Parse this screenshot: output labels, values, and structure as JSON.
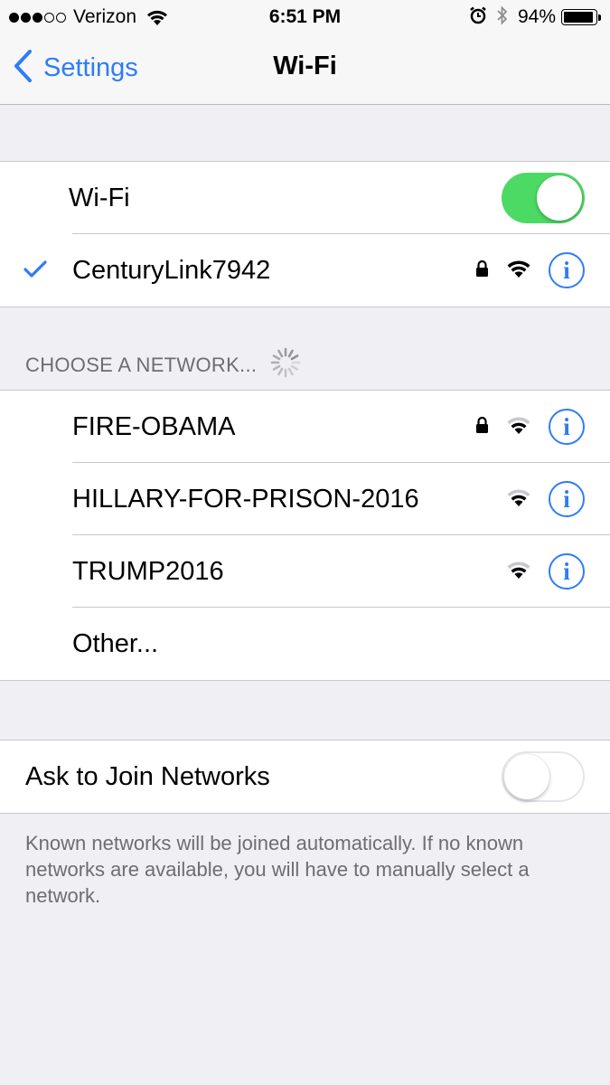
{
  "status_bar": {
    "carrier": "Verizon",
    "signal_full": 3,
    "signal_empty": 2,
    "time": "6:51 PM",
    "battery_percent": "94%",
    "battery_level": 0.94,
    "icons": [
      "wifi-icon",
      "alarm-icon",
      "bluetooth-icon",
      "battery-icon"
    ]
  },
  "nav": {
    "back_label": "Settings",
    "title": "Wi-Fi"
  },
  "wifi_toggle": {
    "label": "Wi-Fi",
    "on": true
  },
  "connected_network": {
    "name": "CenturyLink7942",
    "locked": true,
    "connected": true
  },
  "networks_section": {
    "header": "CHOOSE A NETWORK...",
    "networks": [
      {
        "name": "FIRE-OBAMA",
        "locked": true
      },
      {
        "name": "HILLARY-FOR-PRISON-2016",
        "locked": false
      },
      {
        "name": "TRUMP2016",
        "locked": false
      }
    ],
    "other_label": "Other..."
  },
  "ask_to_join": {
    "label": "Ask to Join Networks",
    "on": false,
    "footer": "Known networks will be joined automatically. If no known networks are available, you will have to manually select a network."
  },
  "colors": {
    "accent": "#2f7cf6",
    "toggle_on": "#4cd964",
    "background": "#efeff4",
    "secondary_text": "#6d6d72"
  }
}
